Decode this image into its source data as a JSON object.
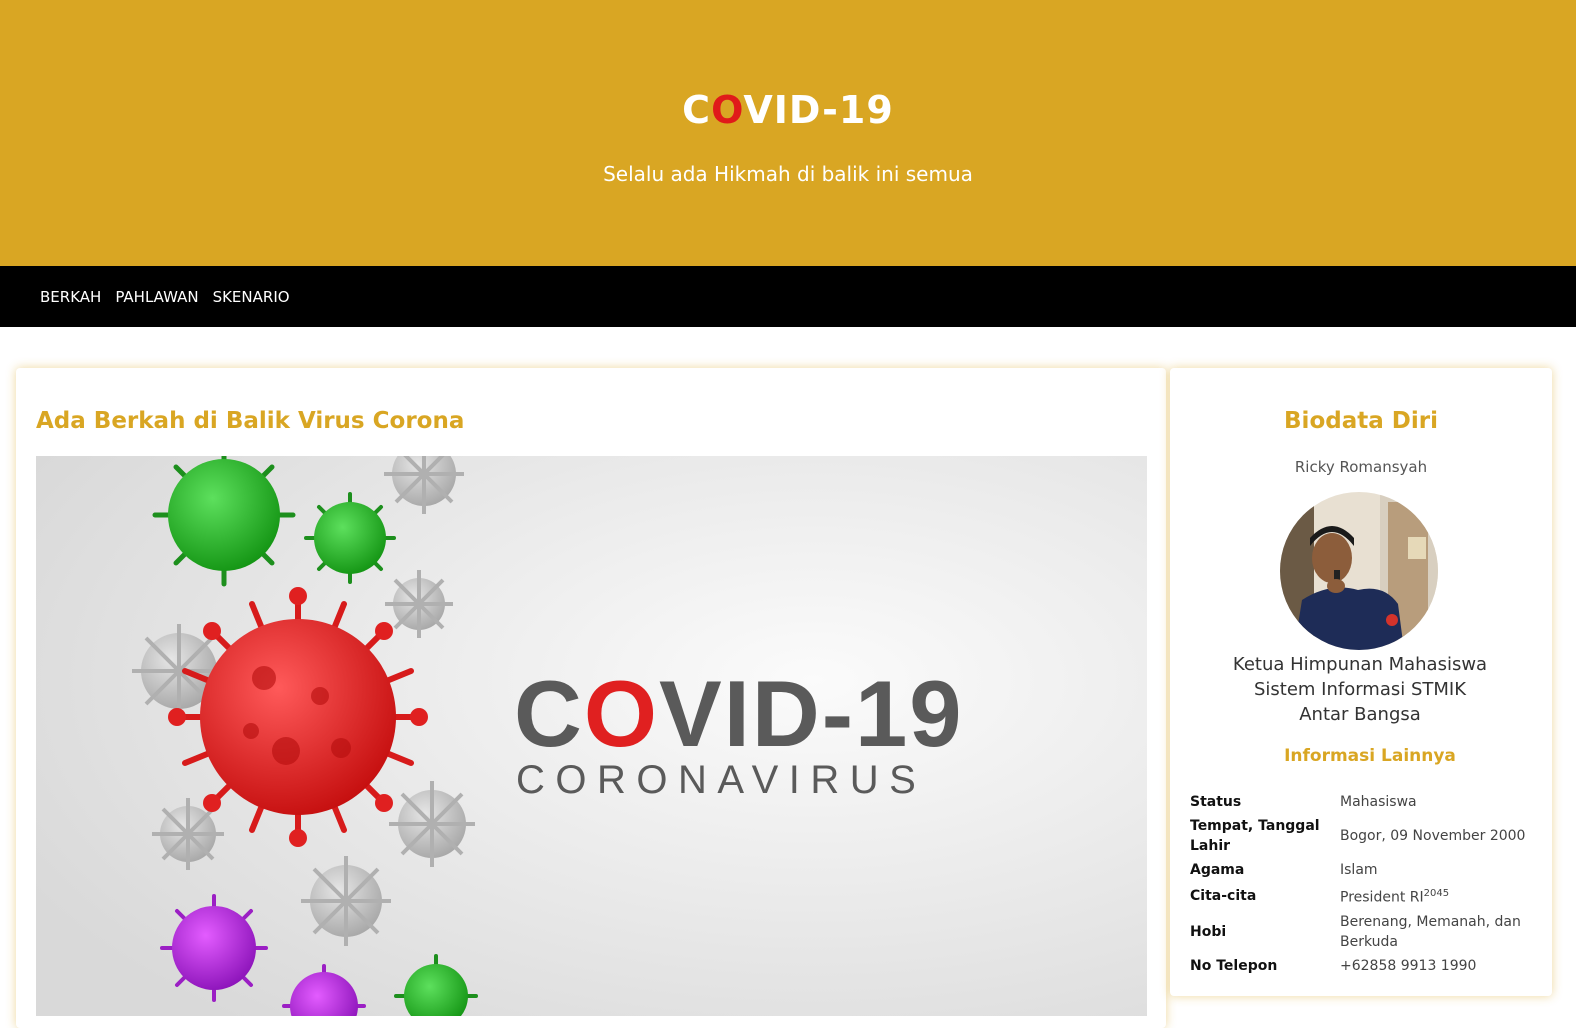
{
  "header": {
    "title_first": "C",
    "title_o": "O",
    "title_rest": "VID-19",
    "subtitle": "Selalu ada Hikmah di balik ini semua"
  },
  "nav": {
    "items": [
      "BERKAH",
      "PAHLAWAN",
      "SKENARIO"
    ]
  },
  "article": {
    "title": "Ada Berkah di Balik Virus Corona",
    "image": {
      "word_c": "C",
      "word_o": "O",
      "word_rest": "VID-19",
      "subtitle": "CORONAVIRUS"
    }
  },
  "sidebar": {
    "title": "Biodata Diri",
    "name": "Ricky Romansyah",
    "role_lines": [
      "Ketua Himpunan Mahasiswa",
      "Sistem Informasi STMIK",
      "Antar Bangsa"
    ],
    "info_title": "Informasi Lainnya",
    "info": [
      {
        "key": "Status",
        "value": "Mahasiswa"
      },
      {
        "key": "Tempat, Tanggal Lahir",
        "value": "Bogor, 09 November 2000"
      },
      {
        "key": "Agama",
        "value": "Islam"
      },
      {
        "key": "Cita-cita",
        "value": "President RI",
        "sup": "2045"
      },
      {
        "key": "Hobi",
        "value": "Berenang, Memanah, dan Berkuda"
      },
      {
        "key": "No Telepon",
        "value": "+62858 9913 1990"
      }
    ]
  },
  "colors": {
    "accent": "#d9a623",
    "nav_bg": "#000000",
    "highlight": "#e01a1a"
  }
}
